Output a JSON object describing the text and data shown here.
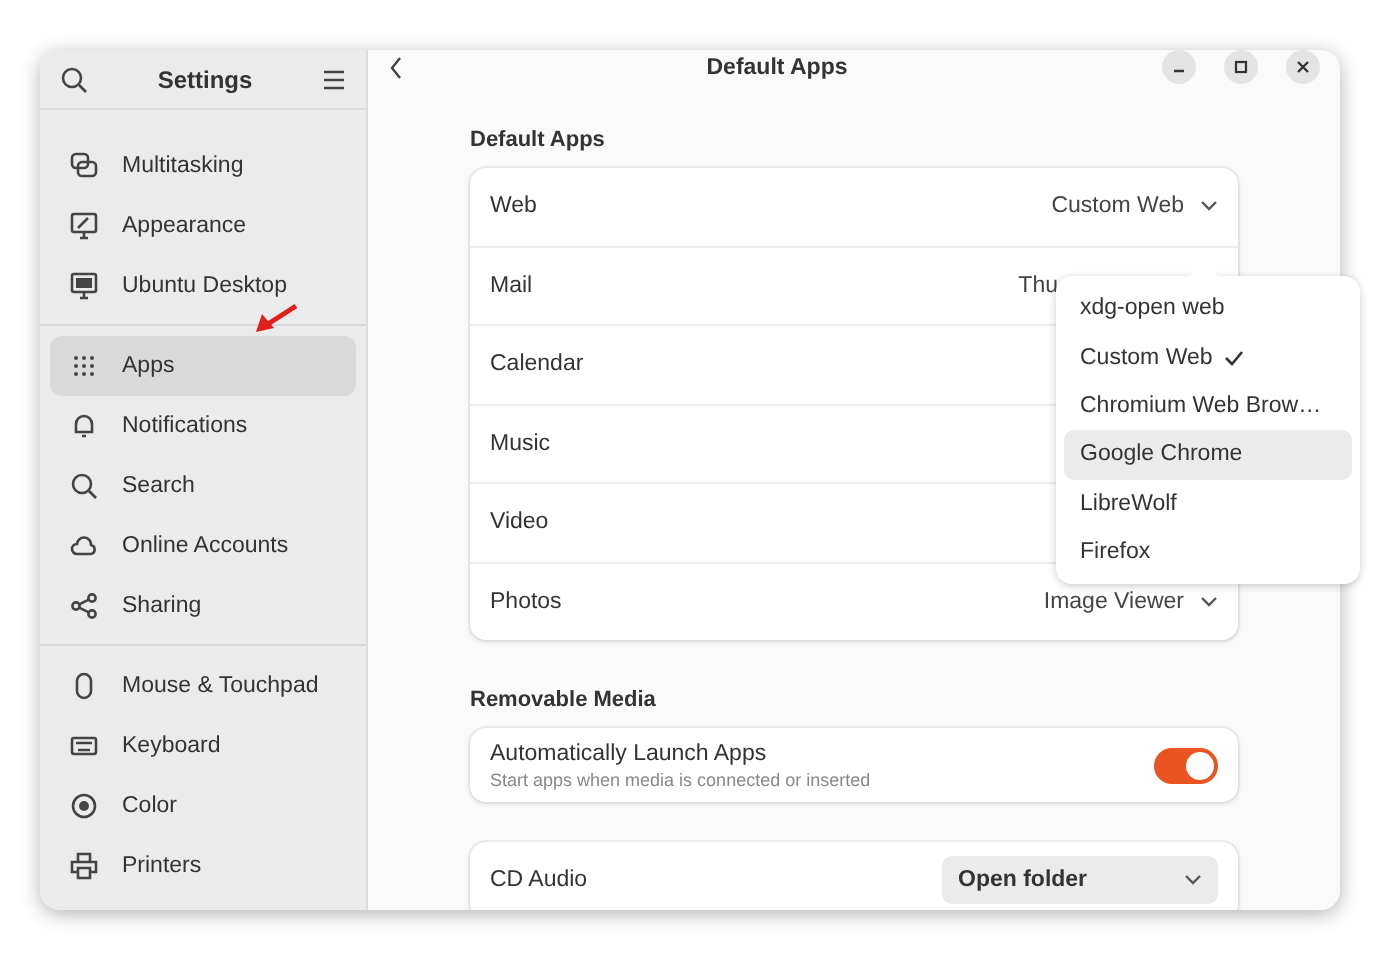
{
  "sidebar": {
    "title": "Settings",
    "groups": [
      [
        {
          "label": "Multitasking",
          "selected": false
        },
        {
          "label": "Appearance",
          "selected": false
        },
        {
          "label": "Ubuntu Desktop",
          "selected": false
        }
      ],
      [
        {
          "label": "Apps",
          "selected": true
        },
        {
          "label": "Notifications",
          "selected": false
        },
        {
          "label": "Search",
          "selected": false
        },
        {
          "label": "Online Accounts",
          "selected": false
        },
        {
          "label": "Sharing",
          "selected": false
        }
      ],
      [
        {
          "label": "Mouse & Touchpad",
          "selected": false
        },
        {
          "label": "Keyboard",
          "selected": false
        },
        {
          "label": "Color",
          "selected": false
        },
        {
          "label": "Printers",
          "selected": false
        }
      ]
    ]
  },
  "window": {
    "title": "Default Apps"
  },
  "default_apps": {
    "heading": "Default Apps",
    "rows": [
      {
        "label": "Web",
        "value": "Custom Web",
        "dropdown": true
      },
      {
        "label": "Mail",
        "value": "Thu",
        "dropdown": false
      },
      {
        "label": "Calendar"
      },
      {
        "label": "Music"
      },
      {
        "label": "Video"
      },
      {
        "label": "Photos",
        "value": "Image Viewer",
        "dropdown": true
      }
    ]
  },
  "removable_media": {
    "heading": "Removable Media",
    "auto_launch": {
      "label": "Automatically Launch Apps",
      "description": "Start apps when media is connected or inserted",
      "on": true
    },
    "rows": [
      {
        "label": "CD Audio",
        "value": "Open folder"
      }
    ]
  },
  "popover": {
    "items": [
      {
        "label": "xdg-open web",
        "selected": false,
        "highlighted": false
      },
      {
        "label": "Custom Web",
        "selected": true,
        "highlighted": false
      },
      {
        "label": "Chromium Web Brow…",
        "selected": false,
        "highlighted": false
      },
      {
        "label": "Google Chrome",
        "selected": false,
        "highlighted": true
      },
      {
        "label": "LibreWolf",
        "selected": false,
        "highlighted": false
      },
      {
        "label": "Firefox",
        "selected": false,
        "highlighted": false
      }
    ]
  }
}
